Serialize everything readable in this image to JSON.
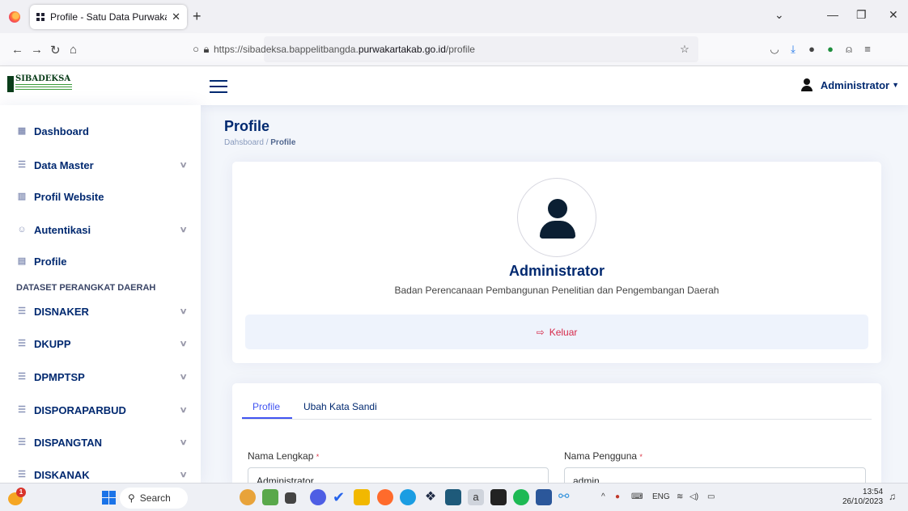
{
  "browser": {
    "tab_title": "Profile - Satu Data Purwakarta",
    "url_prefix": "https://sibadeksa.bappelitbangda.",
    "url_domain": "purwakartakab.go.id",
    "url_path": "/profile"
  },
  "header": {
    "logo_text": "SIBADEKSA",
    "user_name": "Administrator"
  },
  "sidebar": {
    "items": [
      {
        "label": "Dashboard",
        "icon": "grid-icon",
        "glyph": "▦"
      },
      {
        "label": "Data Master",
        "icon": "database-icon",
        "glyph": "☰"
      },
      {
        "label": "Profil Website",
        "icon": "building-icon",
        "glyph": "▥"
      },
      {
        "label": "Autentikasi",
        "icon": "people-icon",
        "glyph": "☺"
      },
      {
        "label": "Profile",
        "icon": "card-icon",
        "glyph": "▤"
      }
    ],
    "section_heading": "DATASET PERANGKAT DAERAH",
    "departments": [
      {
        "label": "DISNAKER"
      },
      {
        "label": "DKUPP"
      },
      {
        "label": "DPMPTSP"
      },
      {
        "label": "DISPORAPARBUD"
      },
      {
        "label": "DISPANGTAN"
      },
      {
        "label": "DISKANAK"
      }
    ]
  },
  "page": {
    "title": "Profile",
    "breadcrumb_root": "Dahsboard",
    "breadcrumb_sep": "/",
    "breadcrumb_current": "Profile"
  },
  "profile_card": {
    "name": "Administrator",
    "organization": "Badan Perencanaan Pembangunan Penelitian dan Pengembangan Daerah",
    "logout_label": "Keluar"
  },
  "form": {
    "tabs": [
      {
        "label": "Profile",
        "active": true
      },
      {
        "label": "Ubah Kata Sandi",
        "active": false
      }
    ],
    "full_name_label": "Nama Lengkap",
    "full_name_value": "Administrator",
    "username_label": "Nama Pengguna",
    "username_value": "admin",
    "required_mark": "*"
  },
  "taskbar": {
    "weather_badge": "1",
    "search_label": "Search",
    "language": "ENG",
    "time": "13:54",
    "date": "26/10/2023"
  },
  "colors": {
    "primary": "#012970",
    "accent": "#4154f1",
    "danger": "#d62a4a",
    "background": "#f3f6fb"
  }
}
